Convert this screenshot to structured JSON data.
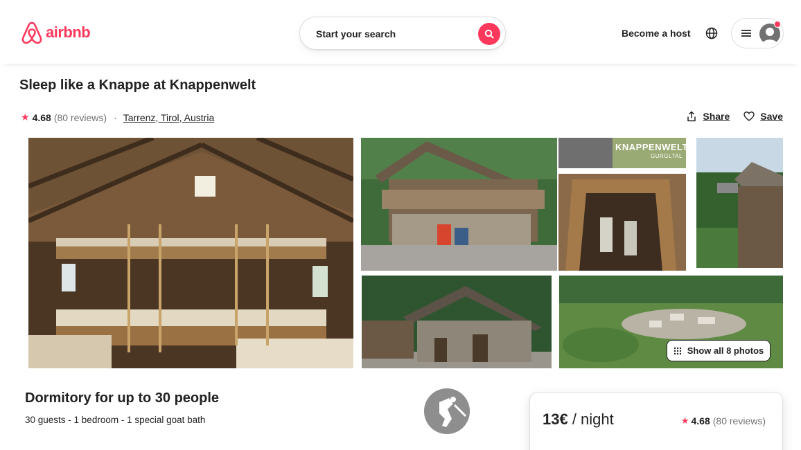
{
  "header": {
    "logo_text": "airbnb",
    "search_placeholder": "Start your search",
    "become_host": "Become a host",
    "brand_color": "#ff385c"
  },
  "listing": {
    "title": "Sleep like a Knappe at Knappenwelt",
    "rating": "4.68",
    "reviews": "(80 reviews)",
    "separator": "·",
    "location": "Tarrenz, Tirol, Austria",
    "share_label": "Share",
    "save_label": "Save"
  },
  "photos": {
    "sign_title": "KNAPPENWELT",
    "sign_subtitle": "GURGLTAL",
    "show_all_label": "Show all 8 photos"
  },
  "details": {
    "title": "Dormitory for up to 30 people",
    "summary": "30 guests - 1 bedroom - 1 special goat bath"
  },
  "booking": {
    "price": "13€",
    "unit": " / night",
    "rating": "4.68",
    "reviews": "(80 reviews)"
  }
}
